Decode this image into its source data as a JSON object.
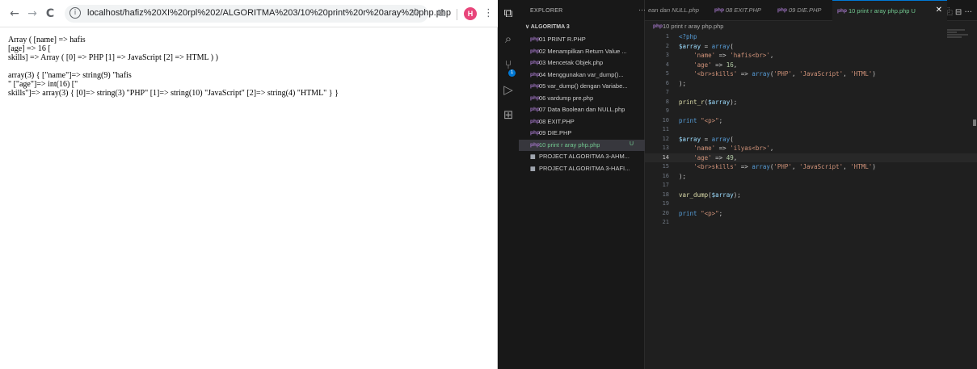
{
  "browser": {
    "back_icon": "←",
    "forward_icon": "→",
    "reload_icon": "C",
    "url": "localhost/hafiz%20XI%20rpl%202/ALGORITMA%203/10%20print%20r%20aray%20php.php",
    "star_icon": "☆",
    "ext_icon": "⧉",
    "avatar_letter": "H",
    "menu_icon": "⋮",
    "page_lines": [
      "Array ( [name] => hafis",
      "[age] => 16 [",
      "skills] => Array ( [0] => PHP [1] => JavaScript [2] => HTML ) )",
      "",
      "array(3) { [\"name\"]=> string(9) \"hafis",
      "\" [\"age\"]=> int(16) [\"",
      "skills\"]=> array(3) { [0]=> string(3) \"PHP\" [1]=> string(10) \"JavaScript\" [2]=> string(4) \"HTML\" } }"
    ]
  },
  "vscode": {
    "explorer_title": "EXPLORER",
    "explorer_more": "···",
    "folder_title": "∨ ALGORITMA 3",
    "tree": [
      {
        "icon": "php",
        "label": "01 PRINT R.PHP"
      },
      {
        "icon": "php",
        "label": "02 Menampilkan Return Value ..."
      },
      {
        "icon": "php",
        "label": "03 Mencetak Objek.php"
      },
      {
        "icon": "php",
        "label": "04 Menggunakan var_dump()..."
      },
      {
        "icon": "php",
        "label": "05 var_dump() dengan Variabe..."
      },
      {
        "icon": "php",
        "label": "06 vardump pre.php"
      },
      {
        "icon": "php",
        "label": "07 Data Boolean dan NULL.php"
      },
      {
        "icon": "php",
        "label": "08 EXIT.PHP"
      },
      {
        "icon": "php",
        "label": "09 DIE.PHP"
      },
      {
        "icon": "php",
        "label": "10 print r aray php.php",
        "modified": "U",
        "selected": true
      },
      {
        "icon": "proj",
        "label": "PROJECT ALGORITMA 3-AHM..."
      },
      {
        "icon": "proj",
        "label": "PROJECT ALGORITMA 3-HAFI..."
      }
    ],
    "tabs": [
      {
        "label": "ean dan NULL.php",
        "icon": ""
      },
      {
        "label": "08 EXIT.PHP",
        "icon": "php"
      },
      {
        "label": "09 DIE.PHP",
        "icon": "php"
      },
      {
        "label": "10 print r aray php.php U",
        "icon": "php",
        "active": true
      }
    ],
    "tab_close": "✕",
    "tab_actions": "⿻ ⊟ ···",
    "breadcrumb": "10 print r aray php.php",
    "php_icon": "php",
    "current_line": 14,
    "code": [
      {
        "n": "1",
        "t": "<?php"
      },
      {
        "n": "2",
        "t": "$array = array("
      },
      {
        "n": "3",
        "t": "    'name' => 'hafis<br>',"
      },
      {
        "n": "4",
        "t": "    'age' => 16,"
      },
      {
        "n": "5",
        "t": "    '<br>skills' => array('PHP', 'JavaScript', 'HTML')"
      },
      {
        "n": "6",
        "t": ");"
      },
      {
        "n": "7",
        "t": ""
      },
      {
        "n": "8",
        "t": "print_r($array);"
      },
      {
        "n": "9",
        "t": ""
      },
      {
        "n": "10",
        "t": "print \"<p>\";"
      },
      {
        "n": "11",
        "t": ""
      },
      {
        "n": "12",
        "t": "$array = array("
      },
      {
        "n": "13",
        "t": "    'name' => 'ilyas<br>',"
      },
      {
        "n": "14",
        "t": "    'age' => 49,"
      },
      {
        "n": "15",
        "t": "    '<br>skills' => array('PHP', 'JavaScript', 'HTML')"
      },
      {
        "n": "16",
        "t": ");"
      },
      {
        "n": "17",
        "t": ""
      },
      {
        "n": "18",
        "t": "var_dump($array);"
      },
      {
        "n": "19",
        "t": ""
      },
      {
        "n": "20",
        "t": "print \"<p>\";"
      },
      {
        "n": "21",
        "t": ""
      }
    ]
  }
}
